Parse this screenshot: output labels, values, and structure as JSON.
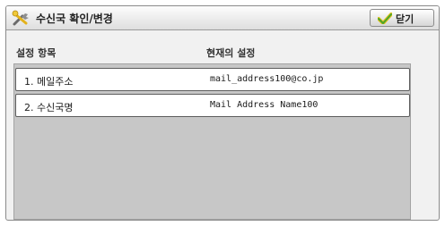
{
  "window": {
    "title": "수신국 확인/변경",
    "icon": "tools-icon",
    "close_label": "닫기",
    "close_icon": "checkmark-icon"
  },
  "columns": {
    "name_header": "설정 항목",
    "value_header": "현재의 설정"
  },
  "items": [
    {
      "name": "1. 메일주소",
      "value": "mail_address100@co.jp"
    },
    {
      "name": "2. 수신국명",
      "value": "Mail Address Name100"
    }
  ],
  "colors": {
    "panel_bg": "#f1f1f1",
    "list_bg": "#c7c7c7",
    "row_bg": "#ffffff",
    "check_green": "#4aa52c",
    "check_yellow": "#e3c21c"
  }
}
